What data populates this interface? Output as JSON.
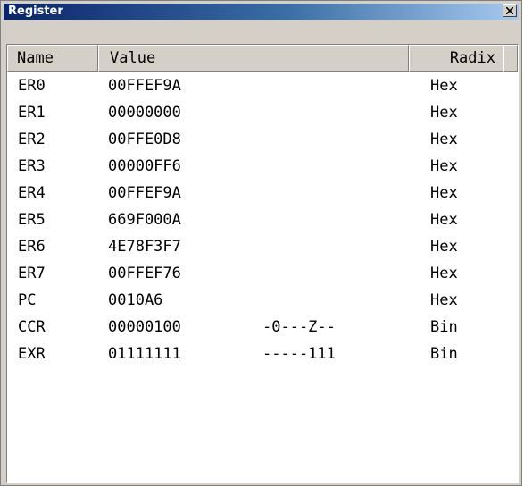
{
  "window": {
    "title": "Register",
    "close_icon": "close-icon"
  },
  "columns": {
    "name": "Name",
    "value": "Value",
    "radix": "Radix"
  },
  "rows": [
    {
      "name": "ER0",
      "value": "00FFEF9A",
      "flags": "",
      "radix": "Hex"
    },
    {
      "name": "ER1",
      "value": "00000000",
      "flags": "",
      "radix": "Hex"
    },
    {
      "name": "ER2",
      "value": "00FFE0D8",
      "flags": "",
      "radix": "Hex"
    },
    {
      "name": "ER3",
      "value": "00000FF6",
      "flags": "",
      "radix": "Hex"
    },
    {
      "name": "ER4",
      "value": "00FFEF9A",
      "flags": "",
      "radix": "Hex"
    },
    {
      "name": "ER5",
      "value": "669F000A",
      "flags": "",
      "radix": "Hex"
    },
    {
      "name": "ER6",
      "value": "4E78F3F7",
      "flags": "",
      "radix": "Hex"
    },
    {
      "name": "ER7",
      "value": "00FFEF76",
      "flags": "",
      "radix": "Hex"
    },
    {
      "name": "PC",
      "value": "0010A6",
      "flags": "",
      "radix": "Hex"
    },
    {
      "name": "CCR",
      "value": "00000100",
      "flags": "-0---Z--",
      "radix": "Bin"
    },
    {
      "name": "EXR",
      "value": "01111111",
      "flags": "-----111",
      "radix": "Bin"
    }
  ]
}
